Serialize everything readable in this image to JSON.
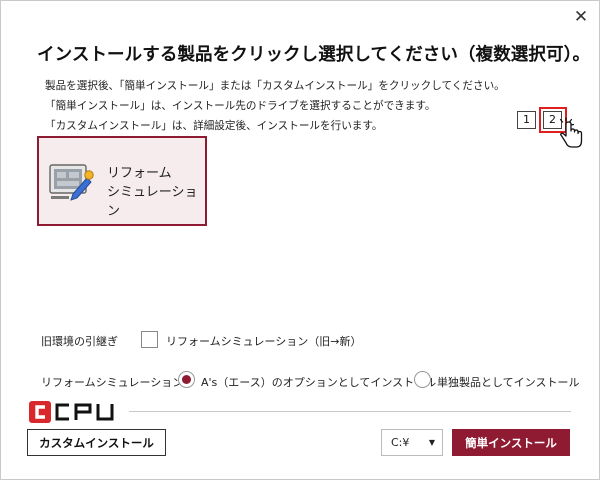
{
  "window": {
    "close_glyph": "✕"
  },
  "title": "インストールする製品をクリックし選択してください（複数選択可）。",
  "description": [
    "製品を選択後、「簡単インストール」または「カスタムインストール」をクリックしてください。",
    "「簡単インストール」は、インストール先のドライブを選択することができます。",
    "「カスタムインストール」は、詳細設定後、インストールを行います。"
  ],
  "pagination": {
    "pages": [
      "1",
      "2"
    ],
    "current": "2"
  },
  "products": [
    {
      "name": "リフォーム\nシミュレーション",
      "icon": "reform-simulation-icon",
      "selected": true
    }
  ],
  "migration": {
    "label": "旧環境の引継ぎ",
    "option": "リフォームシミュレーション（旧→新）",
    "checked": false
  },
  "install_mode": {
    "label": "リフォームシミュレーション",
    "options": [
      "A's（エース）のオプションとしてインストール",
      "単独製品としてインストール"
    ],
    "selected": 0
  },
  "brand": {
    "logo_text": "CPU",
    "logo_icon": "cpu-logo-icon"
  },
  "buttons": {
    "custom_install": "カスタムインストール",
    "simple_install": "簡単インストール"
  },
  "drive": {
    "value": "C:¥",
    "arrow": "▼"
  },
  "colors": {
    "accent": "#8e1b32",
    "selected_card_bg": "#f6eced",
    "highlight_red": "#e02020",
    "logo_red": "#d9282b"
  }
}
